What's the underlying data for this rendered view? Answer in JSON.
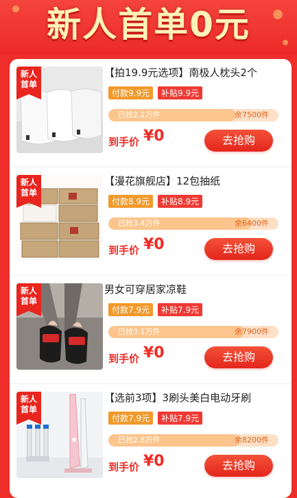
{
  "banner": {
    "title": "新人首单0元"
  },
  "colors": {
    "brand_red": "#e8251e",
    "pay_tag": "#f19a2c",
    "subsidy_tag": "#ef3a34"
  },
  "products": [
    {
      "ribbon_line1": "新人",
      "ribbon_line2": "首单",
      "title": "【拍19.9元选项】南极人枕头2个",
      "pay_tag": "付款9.9元",
      "subsidy_tag": "补贴9.9元",
      "sold": "已抢2.2万件",
      "remain": "余7500件",
      "sold_fraction": 0.75,
      "price_label": "到手价",
      "price": "¥0",
      "button": "去抢购",
      "image_icon": "pillow-image"
    },
    {
      "ribbon_line1": "新人",
      "ribbon_line2": "首单",
      "title": "【漫花旗舰店】12包抽纸",
      "pay_tag": "付款8.9元",
      "subsidy_tag": "补贴8.9元",
      "sold": "已抢3.4万件",
      "remain": "余6400件",
      "sold_fraction": 0.84,
      "price_label": "到手价",
      "price": "¥0",
      "button": "去抢购",
      "image_icon": "tissue-image"
    },
    {
      "ribbon_line1": "新人",
      "ribbon_line2": "首单",
      "title": "男女可穿居家凉鞋",
      "pay_tag": "付款7.9元",
      "subsidy_tag": "补贴7.9元",
      "sold": "已抢3.1万件",
      "remain": "余7900件",
      "sold_fraction": 0.8,
      "price_label": "到手价",
      "price": "¥0",
      "button": "去抢购",
      "image_icon": "sandal-image"
    },
    {
      "ribbon_line1": "新人",
      "ribbon_line2": "首单",
      "title": "【选前3项】3刷头美白电动牙刷",
      "pay_tag": "付款7.9元",
      "subsidy_tag": "补贴7.9元",
      "sold": "已抢2.8万件",
      "remain": "余8200件",
      "sold_fraction": 0.77,
      "price_label": "到手价",
      "price": "¥0",
      "button": "去抢购",
      "image_icon": "toothbrush-image"
    }
  ]
}
